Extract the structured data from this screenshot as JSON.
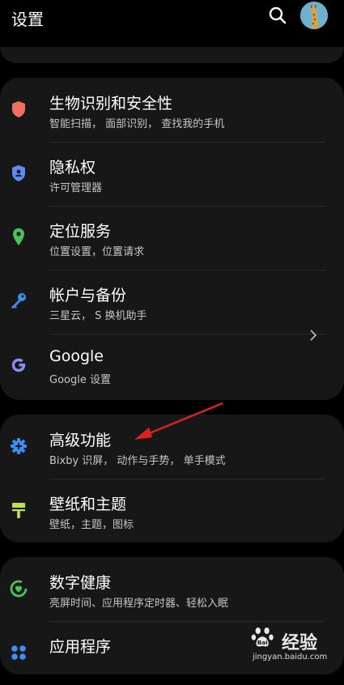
{
  "header": {
    "title": "设置"
  },
  "settings": [
    {
      "title": "生物识别和安全性",
      "subtitle": "智能扫描， 面部识别， 查找我的手机",
      "icon": "shield-icon",
      "color": "#ef6f63"
    },
    {
      "title": "隐私权",
      "subtitle": "许可管理器",
      "icon": "privacy-shield-icon",
      "color": "#5e8bf0"
    },
    {
      "title": "定位服务",
      "subtitle": "位置设置，位置请求",
      "icon": "location-pin-icon",
      "color": "#4cc25a"
    },
    {
      "title": "帐户与备份",
      "subtitle": "三星云， S 换机助手",
      "icon": "key-icon",
      "color": "#3d8ef5"
    },
    {
      "title": "Google",
      "subtitle": "Google 设置",
      "icon": "google-g-icon",
      "color": "#8c8cf5"
    },
    {
      "title": "高级功能",
      "subtitle": "Bixby 识屏， 动作与手势， 单手模式",
      "icon": "gear-plus-icon",
      "color": "#3d8ef5"
    },
    {
      "title": "壁纸和主题",
      "subtitle": "壁纸，主题，图标",
      "icon": "paint-roller-icon",
      "color": "#c2e04a"
    },
    {
      "title": "数字健康",
      "subtitle": "亮屏时间、应用程序定时器、轻松入眠",
      "icon": "wellbeing-icon",
      "color": "#4cc25a"
    },
    {
      "title": "应用程序",
      "subtitle": "",
      "icon": "apps-grid-icon",
      "color": "#3d8ef5"
    }
  ],
  "watermark": {
    "brand": "Bai",
    "name": "经验",
    "url": "jingyan.baidu.com"
  },
  "annotation": {
    "arrow_color": "#e02020"
  }
}
